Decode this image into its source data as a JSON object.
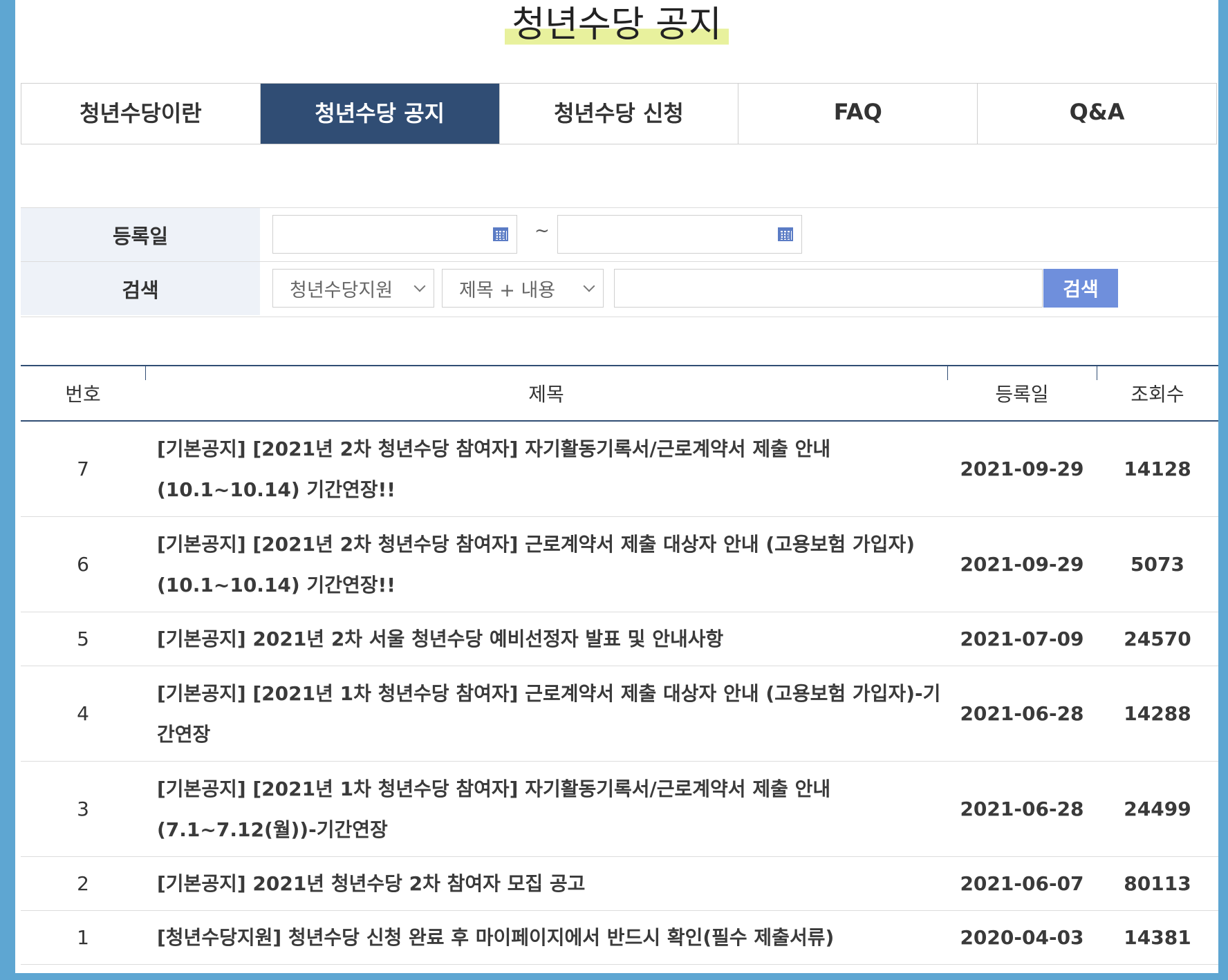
{
  "page": {
    "title": "청년수당 공지"
  },
  "tabs": [
    {
      "label": "청년수당이란"
    },
    {
      "label": "청년수당 공지"
    },
    {
      "label": "청년수당 신청"
    },
    {
      "label": "FAQ"
    },
    {
      "label": "Q&A"
    }
  ],
  "search": {
    "date_label": "등록일",
    "date_separator": "~",
    "date_from_value": "",
    "date_to_value": "",
    "search_label": "검색",
    "category_selected": "청년수당지원",
    "field_selected": "제목 + 내용",
    "keyword_value": "",
    "button_label": "검색"
  },
  "table": {
    "headers": {
      "no": "번호",
      "title": "제목",
      "date": "등록일",
      "views": "조회수"
    },
    "rows": [
      {
        "no": "7",
        "title": "[기본공지] [2021년 2차 청년수당 참여자] 자기활동기록서/근로계약서 제출 안내(10.1~10.14) 기간연장!!",
        "date": "2021-09-29",
        "views": "14128"
      },
      {
        "no": "6",
        "title": "[기본공지] [2021년 2차 청년수당 참여자] 근로계약서 제출 대상자 안내 (고용보험 가입자) (10.1~10.14) 기간연장!!",
        "date": "2021-09-29",
        "views": "5073"
      },
      {
        "no": "5",
        "title": "[기본공지] 2021년 2차 서울 청년수당 예비선정자 발표 및 안내사항",
        "date": "2021-07-09",
        "views": "24570"
      },
      {
        "no": "4",
        "title": "[기본공지] [2021년 1차 청년수당 참여자] 근로계약서 제출 대상자 안내 (고용보험 가입자)-기간연장",
        "date": "2021-06-28",
        "views": "14288"
      },
      {
        "no": "3",
        "title": "[기본공지] [2021년 1차 청년수당 참여자] 자기활동기록서/근로계약서 제출 안내 (7.1~7.12(월))-기간연장",
        "date": "2021-06-28",
        "views": "24499"
      },
      {
        "no": "2",
        "title": "[기본공지] 2021년 청년수당 2차 참여자 모집 공고",
        "date": "2021-06-07",
        "views": "80113"
      },
      {
        "no": "1",
        "title": "[청년수당지원] 청년수당 신청 완료 후 마이페이지에서 반드시 확인(필수 제출서류)",
        "date": "2020-04-03",
        "views": "14381"
      }
    ]
  },
  "colors": {
    "active_tab": "#304d74",
    "search_button": "#6f8fdc",
    "title_highlight": "#e8f19d",
    "label_bg": "#eef2f8"
  }
}
